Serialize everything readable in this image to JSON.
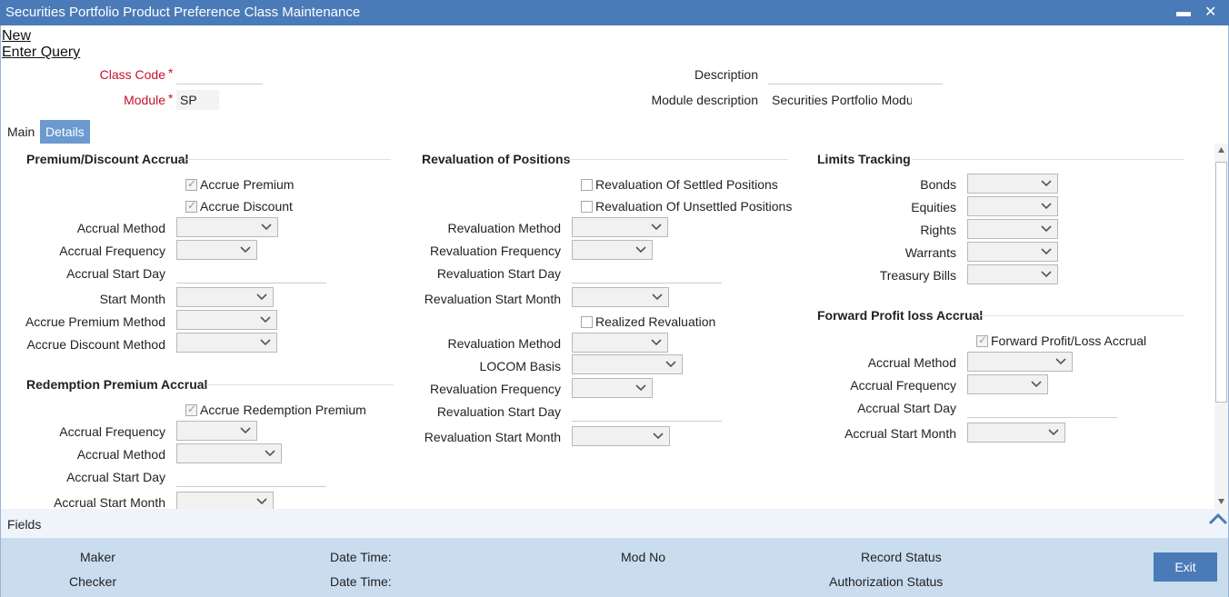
{
  "window": {
    "title": "Securities Portfolio Product Preference Class Maintenance",
    "minimize": "▬",
    "close": "✕"
  },
  "toolbar": {
    "new": "New",
    "enter_query": "Enter Query"
  },
  "header": {
    "class_code_label": "Class Code",
    "class_code_value": "",
    "module_label": "Module",
    "module_value": "SP",
    "description_label": "Description",
    "description_value": "",
    "module_description_label": "Module description",
    "module_description_value": "Securities Portfolio Module",
    "required_mark": "*"
  },
  "tabs": {
    "main": "Main",
    "details": "Details",
    "active": "Details"
  },
  "premium_discount": {
    "title": "Premium/Discount Accrual",
    "accrue_premium": {
      "label": "Accrue Premium",
      "checked": true
    },
    "accrue_discount": {
      "label": "Accrue Discount",
      "checked": true
    },
    "accrual_method": "Accrual Method",
    "accrual_frequency": "Accrual Frequency",
    "accrual_start_day": "Accrual Start Day",
    "start_month": "Start Month",
    "accrue_premium_method": "Accrue Premium Method",
    "accrue_discount_method": "Accrue Discount Method"
  },
  "redemption": {
    "title": "Redemption Premium Accrual",
    "accrue_redemption_premium": {
      "label": "Accrue Redemption Premium",
      "checked": true
    },
    "accrual_frequency": "Accrual Frequency",
    "accrual_method": "Accrual Method",
    "accrual_start_day": "Accrual Start Day",
    "accrual_start_month": "Accrual Start Month"
  },
  "revaluation": {
    "title": "Revaluation of Positions",
    "settled": {
      "label": "Revaluation Of Settled Positions",
      "checked": false
    },
    "unsettled": {
      "label": "Revaluation Of Unsettled Positions",
      "checked": false
    },
    "method": "Revaluation Method",
    "frequency": "Revaluation Frequency",
    "start_day": "Revaluation Start Day",
    "start_month": "Revaluation Start Month",
    "realized": {
      "label": "Realized Revaluation",
      "checked": false
    },
    "method2": "Revaluation Method",
    "locom_basis": "LOCOM Basis",
    "frequency2": "Revaluation Frequency",
    "start_day2": "Revaluation Start Day",
    "start_month2": "Revaluation Start Month"
  },
  "limits": {
    "title": "Limits Tracking",
    "bonds": "Bonds",
    "equities": "Equities",
    "rights": "Rights",
    "warrants": "Warrants",
    "treasury_bills": "Treasury Bills"
  },
  "forward_pl": {
    "title": "Forward Profit loss Accrual",
    "forward_accrual": {
      "label": "Forward Profit/Loss Accrual",
      "checked": true
    },
    "accrual_method": "Accrual Method",
    "accrual_frequency": "Accrual Frequency",
    "accrual_start_day": "Accrual Start Day",
    "accrual_start_month": "Accrual Start Month"
  },
  "fields_bar": {
    "label": "Fields"
  },
  "footer": {
    "maker": "Maker",
    "checker": "Checker",
    "date_time_1": "Date Time:",
    "date_time_2": "Date Time:",
    "mod_no": "Mod No",
    "record_status": "Record Status",
    "authorization_status": "Authorization Status",
    "exit": "Exit"
  }
}
